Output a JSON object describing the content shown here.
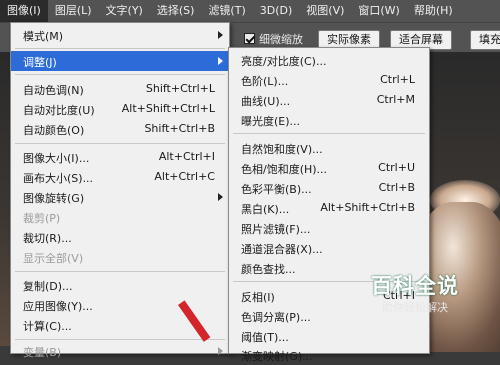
{
  "menubar": {
    "items": [
      {
        "label": "图像(I)",
        "active": true
      },
      {
        "label": "图层(L)"
      },
      {
        "label": "文字(Y)"
      },
      {
        "label": "选择(S)"
      },
      {
        "label": "滤镜(T)"
      },
      {
        "label": "3D(D)"
      },
      {
        "label": "视图(V)"
      },
      {
        "label": "窗口(W)"
      },
      {
        "label": "帮助(H)"
      }
    ]
  },
  "options_bar": {
    "scrubby_zoom": {
      "label": "细微缩放",
      "checked": true
    },
    "actual_pixels_label": "实际像素",
    "fit_screen_label": "适合屏幕",
    "fill_screen_label": "填充"
  },
  "image_menu": {
    "items": [
      {
        "label": "模式(M)",
        "submenu": true
      },
      {
        "label": "调整(J)",
        "submenu": true,
        "highlighted": true
      },
      {
        "label": "自动色调(N)",
        "shortcut": "Shift+Ctrl+L"
      },
      {
        "label": "自动对比度(U)",
        "shortcut": "Alt+Shift+Ctrl+L"
      },
      {
        "label": "自动颜色(O)",
        "shortcut": "Shift+Ctrl+B"
      },
      {
        "label": "图像大小(I)...",
        "shortcut": "Alt+Ctrl+I"
      },
      {
        "label": "画布大小(S)...",
        "shortcut": "Alt+Ctrl+C"
      },
      {
        "label": "图像旋转(G)",
        "submenu": true
      },
      {
        "label": "裁剪(P)",
        "disabled": true
      },
      {
        "label": "裁切(R)..."
      },
      {
        "label": "显示全部(V)",
        "disabled": true
      },
      {
        "label": "复制(D)..."
      },
      {
        "label": "应用图像(Y)..."
      },
      {
        "label": "计算(C)..."
      },
      {
        "label": "变量(B)",
        "submenu": true,
        "disabled": true
      }
    ]
  },
  "adjust_submenu": {
    "items": [
      {
        "label": "亮度/对比度(C)..."
      },
      {
        "label": "色阶(L)...",
        "shortcut": "Ctrl+L"
      },
      {
        "label": "曲线(U)...",
        "shortcut": "Ctrl+M"
      },
      {
        "label": "曝光度(E)..."
      },
      {
        "label": "自然饱和度(V)..."
      },
      {
        "label": "色相/饱和度(H)...",
        "shortcut": "Ctrl+U"
      },
      {
        "label": "色彩平衡(B)...",
        "shortcut": "Ctrl+B"
      },
      {
        "label": "黑白(K)...",
        "shortcut": "Alt+Shift+Ctrl+B"
      },
      {
        "label": "照片滤镜(F)..."
      },
      {
        "label": "通道混合器(X)..."
      },
      {
        "label": "颜色查找..."
      },
      {
        "label": "反相(I)",
        "shortcut": "Ctrl+I"
      },
      {
        "label": "色调分离(P)..."
      },
      {
        "label": "阈值(T)..."
      },
      {
        "label": "渐变映射(G)..."
      }
    ]
  },
  "watermark": {
    "title": "百科全说",
    "subtitle": "助你轻松解决"
  }
}
